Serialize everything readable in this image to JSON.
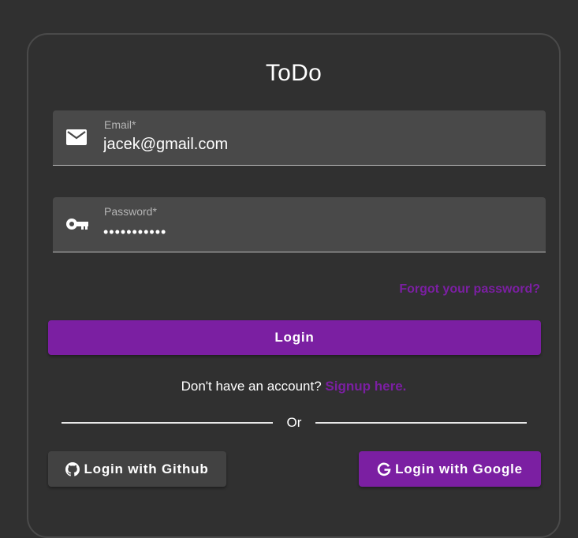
{
  "app": {
    "title": "ToDo"
  },
  "form": {
    "email": {
      "label": "Email*",
      "value": "jacek@gmail.com",
      "icon": "mail-icon"
    },
    "password": {
      "label": "Password*",
      "value": "•••••••••••",
      "icon": "key-icon"
    },
    "forgot_label": "Forgot your password?",
    "login_label": "Login"
  },
  "signup": {
    "prompt": "Don't have an account?",
    "link_label": "Signup here."
  },
  "divider": {
    "label": "Or"
  },
  "social": {
    "github_label": "Login with Github",
    "github_icon": "github-icon",
    "google_label": "Login with Google",
    "google_icon": "google-icon"
  },
  "colors": {
    "background": "#303030",
    "field": "#494949",
    "accent": "#7b1fa2",
    "github_button": "#424242",
    "text": "#ffffff",
    "muted_label": "#b5b5b5"
  }
}
